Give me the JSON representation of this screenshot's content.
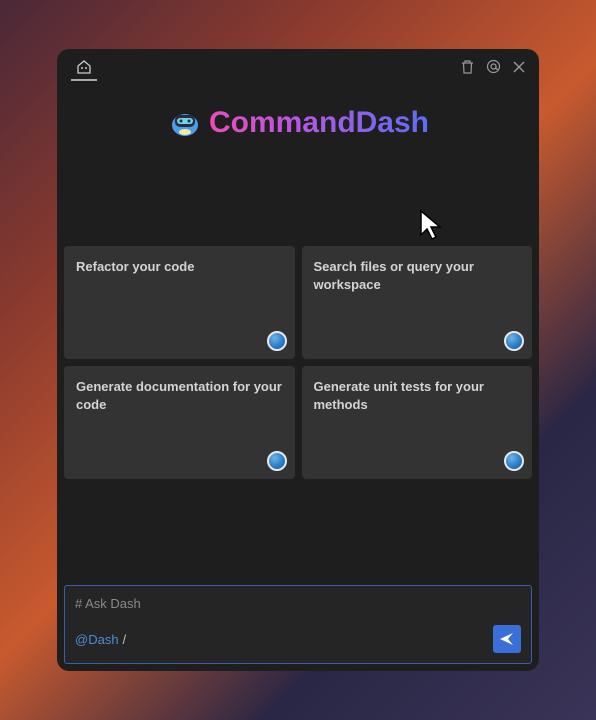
{
  "header": {
    "tab_icon": "bot-tab-icon"
  },
  "logo": {
    "text": "CommandDash"
  },
  "cards": [
    {
      "title": "Refactor your code"
    },
    {
      "title": "Search files or query your workspace"
    },
    {
      "title": "Generate documentation for your code"
    },
    {
      "title": "Generate unit tests for your methods"
    }
  ],
  "input": {
    "header": "# Ask Dash",
    "mention": "@Dash",
    "command": "/"
  }
}
